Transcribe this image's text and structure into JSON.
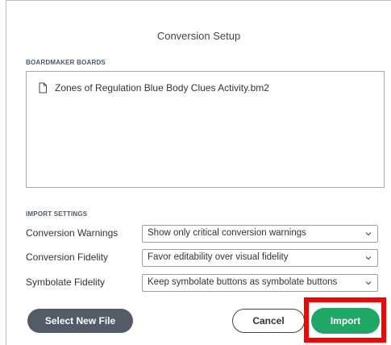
{
  "dialog": {
    "title": "Conversion Setup"
  },
  "boards": {
    "section_label": "BOARDMAKER BOARDS",
    "files": [
      {
        "name": "Zones of Regulation Blue Body Clues Activity.bm2",
        "icon": "file-icon"
      }
    ]
  },
  "import_settings": {
    "section_label": "IMPORT SETTINGS",
    "rows": [
      {
        "label": "Conversion Warnings",
        "value": "Show only critical conversion warnings"
      },
      {
        "label": "Conversion Fidelity",
        "value": "Favor editability over visual fidelity"
      },
      {
        "label": "Symbolate Fidelity",
        "value": "Keep symbolate buttons as symbolate buttons"
      }
    ]
  },
  "buttons": {
    "select_new_file": "Select New File",
    "cancel": "Cancel",
    "import": "Import"
  },
  "colors": {
    "select_new_file_bg": "#525b66",
    "import_bg": "#1fa865",
    "highlight": "#ff0000"
  }
}
